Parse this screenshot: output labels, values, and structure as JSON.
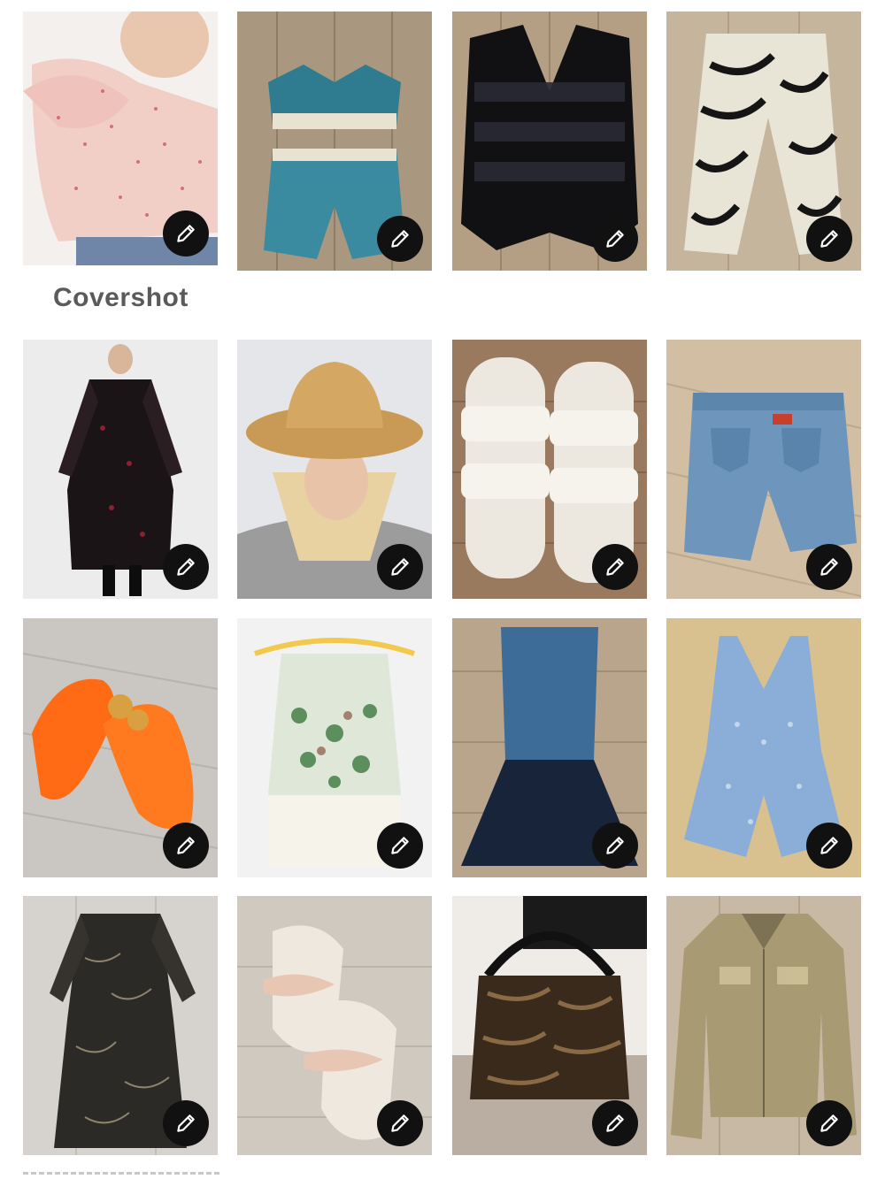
{
  "covershot_label": "Covershot",
  "edit_icon": "pencil-icon",
  "tiles": [
    {
      "name": "pink-floral-ruffle-top"
    },
    {
      "name": "crochet-set-blue"
    },
    {
      "name": "black-sequin-vest"
    },
    {
      "name": "zebra-print-pants"
    },
    {
      "name": "black-sheer-maxi-dress"
    },
    {
      "name": "straw-hat-selfie"
    },
    {
      "name": "white-buckle-sandals"
    },
    {
      "name": "levis-jeans"
    },
    {
      "name": "orange-jelly-sandals"
    },
    {
      "name": "floral-crochet-top"
    },
    {
      "name": "denim-vest-with-skirt"
    },
    {
      "name": "blue-floral-romper"
    },
    {
      "name": "black-print-maxi-dress"
    },
    {
      "name": "striped-bow-mules"
    },
    {
      "name": "zebra-shoulder-bag"
    },
    {
      "name": "gold-metallic-jacket"
    }
  ],
  "colors": {
    "edit_button_bg": "#111111",
    "label_text": "#5a5a5a"
  }
}
